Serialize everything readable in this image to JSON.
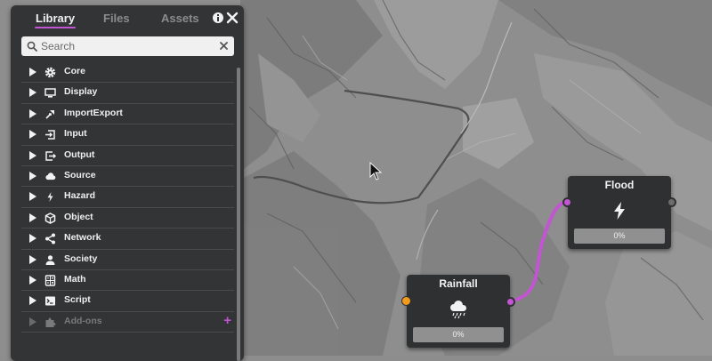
{
  "panel": {
    "tabs": [
      {
        "label": "Library",
        "active": true
      },
      {
        "label": "Files",
        "active": false
      },
      {
        "label": "Assets",
        "active": false
      }
    ],
    "search_placeholder": "Search",
    "categories": [
      {
        "label": "Core",
        "icon": "gear-icon"
      },
      {
        "label": "Display",
        "icon": "monitor-icon"
      },
      {
        "label": "ImportExport",
        "icon": "import-export-icon"
      },
      {
        "label": "Input",
        "icon": "input-icon"
      },
      {
        "label": "Output",
        "icon": "output-icon"
      },
      {
        "label": "Source",
        "icon": "cloud-icon"
      },
      {
        "label": "Hazard",
        "icon": "bolt-icon"
      },
      {
        "label": "Object",
        "icon": "cube-icon"
      },
      {
        "label": "Network",
        "icon": "share-icon"
      },
      {
        "label": "Society",
        "icon": "person-icon"
      },
      {
        "label": "Math",
        "icon": "calculator-icon"
      },
      {
        "label": "Script",
        "icon": "terminal-icon"
      },
      {
        "label": "Add-ons",
        "icon": "puzzle-icon",
        "disabled": true
      }
    ]
  },
  "nodes": {
    "flood": {
      "title": "Flood",
      "progress": "0%",
      "icon": "bolt-icon"
    },
    "rainfall": {
      "title": "Rainfall",
      "progress": "0%",
      "icon": "rain-cloud-icon"
    }
  },
  "colors": {
    "accent": "#c255d1",
    "input_port": "#f29a1c",
    "connection": "#c255d1",
    "panel_bg": "#333436"
  }
}
